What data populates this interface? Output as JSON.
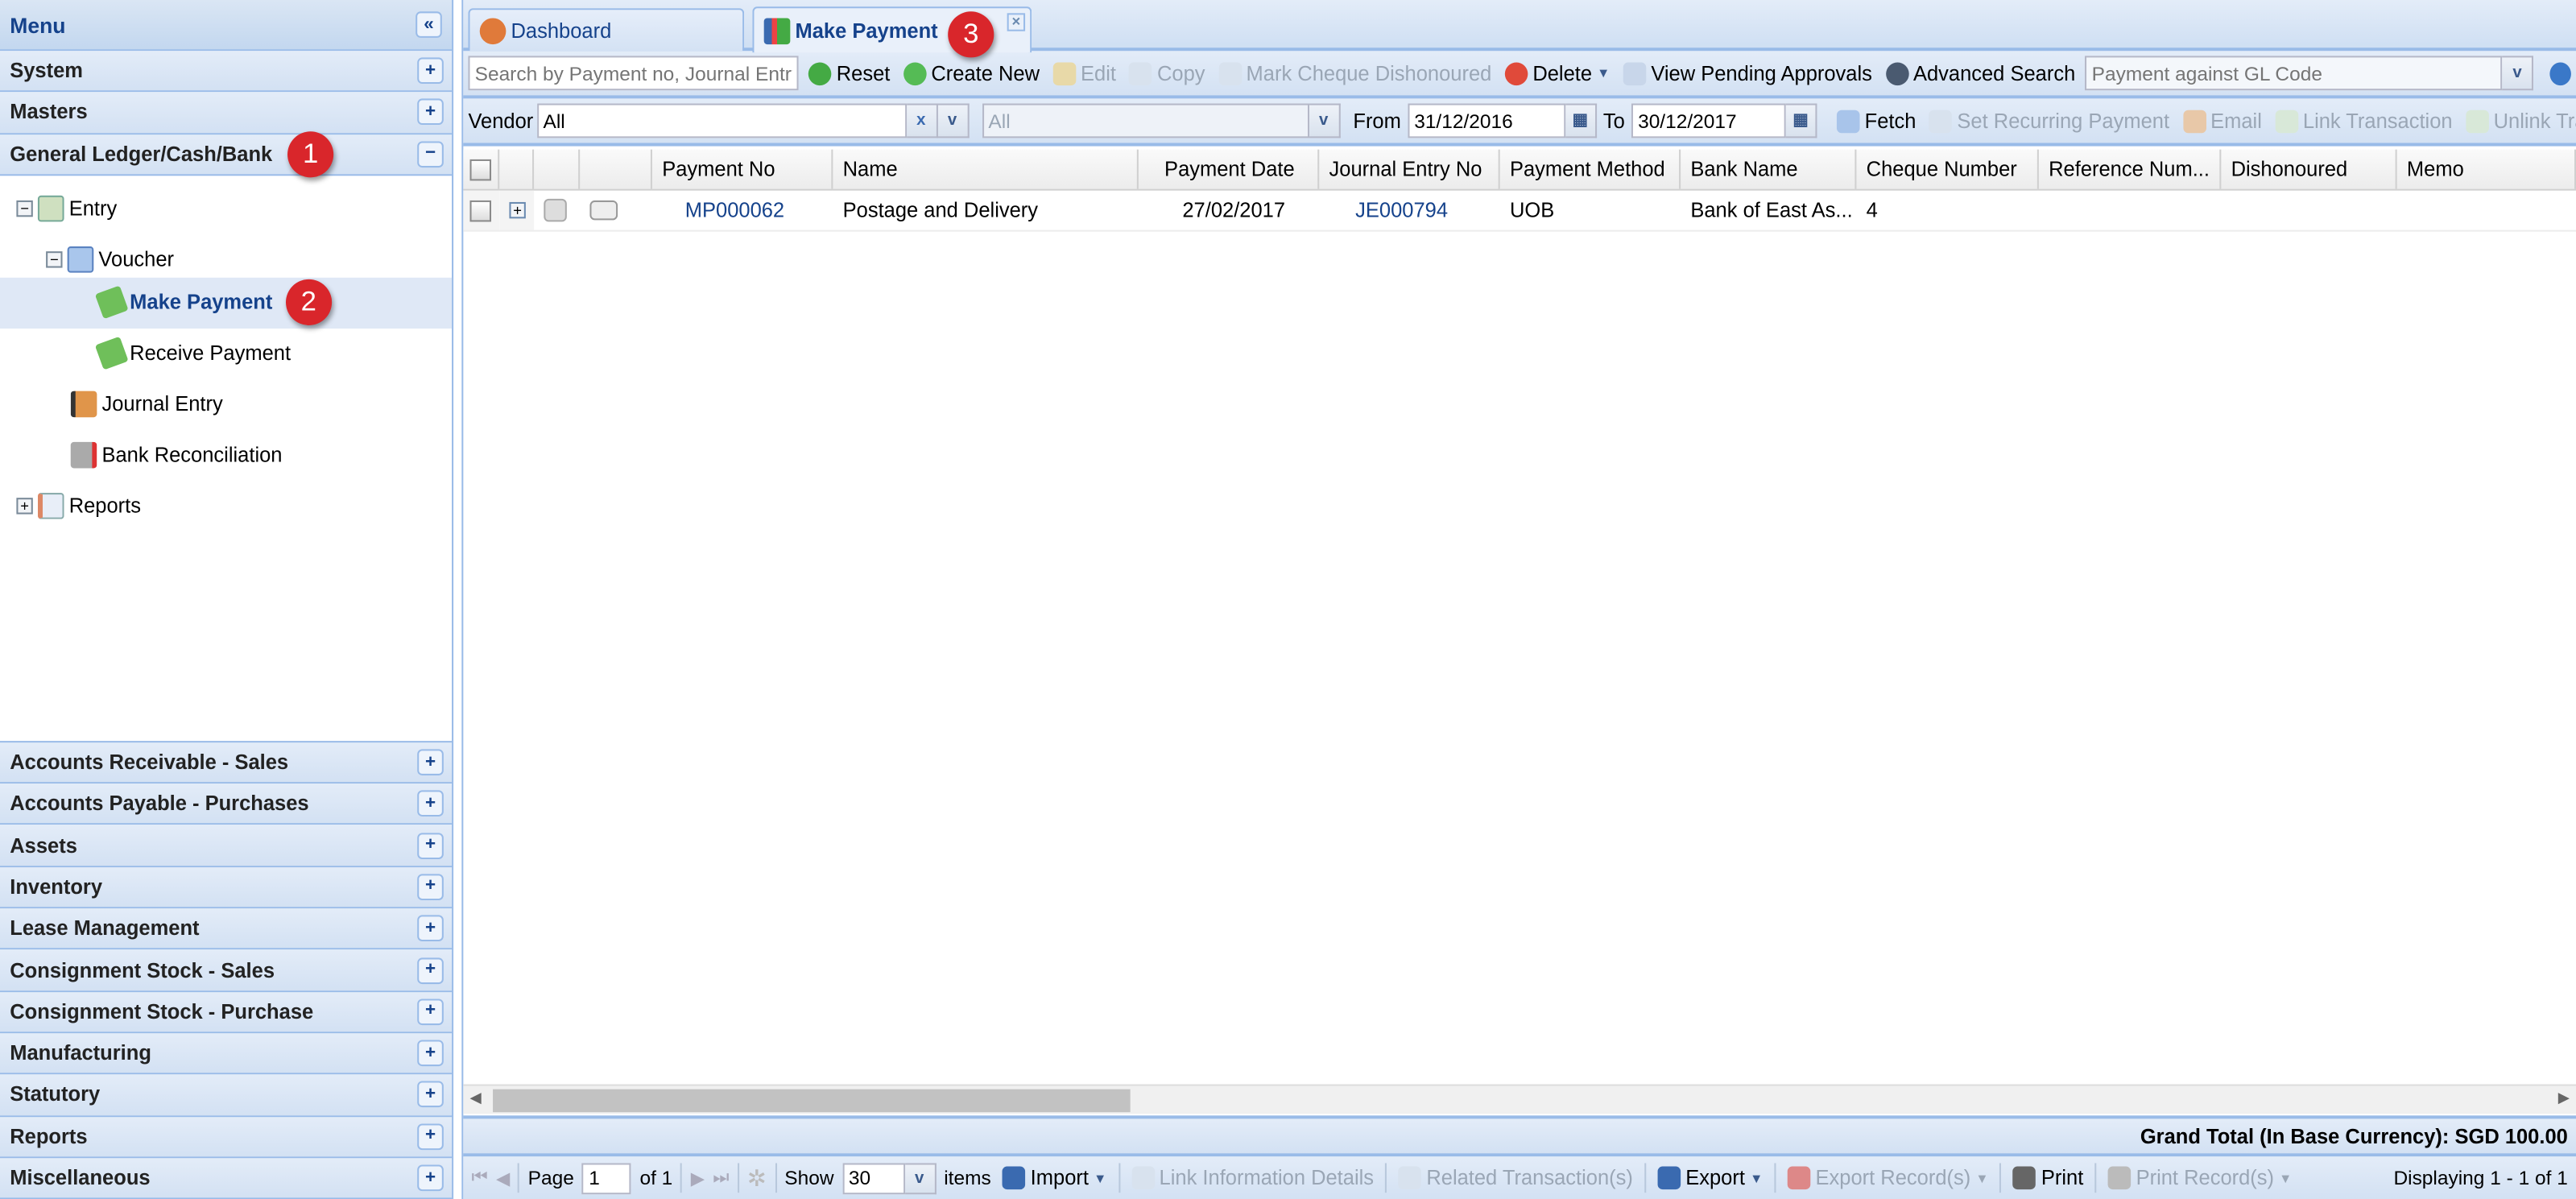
{
  "sidebar": {
    "title": "Menu",
    "top_sections": [
      {
        "label": "System",
        "state": "collapsed"
      },
      {
        "label": "Masters",
        "state": "collapsed"
      },
      {
        "label": "General Ledger/Cash/Bank",
        "state": "expanded",
        "badge": "1"
      }
    ],
    "tree": [
      {
        "label": "Entry",
        "icon": "entry-icon",
        "expanded": true
      },
      {
        "label": "Voucher",
        "icon": "voucher-icon",
        "expanded": true
      },
      {
        "label": "Make Payment",
        "icon": "money-icon",
        "selected": true,
        "badge": "2"
      },
      {
        "label": "Receive Payment",
        "icon": "money-icon"
      },
      {
        "label": "Journal Entry",
        "icon": "journal-icon"
      },
      {
        "label": "Bank Reconciliation",
        "icon": "bank-icon"
      },
      {
        "label": "Reports",
        "icon": "report-icon",
        "expanded": false
      }
    ],
    "bottom_sections": [
      "Accounts Receivable - Sales",
      "Accounts Payable - Purchases",
      "Assets",
      "Inventory",
      "Lease Management",
      "Consignment Stock - Sales",
      "Consignment Stock - Purchase",
      "Manufacturing",
      "Statutory",
      "Reports",
      "Miscellaneous"
    ]
  },
  "tabs": [
    {
      "label": "Dashboard"
    },
    {
      "label": "Make Payment",
      "active": true,
      "badge": "3"
    }
  ],
  "toolbar1": {
    "search_placeholder": "Search by Payment no, Journal Entry no",
    "reset": "Reset",
    "create_new": "Create New",
    "edit": "Edit",
    "copy": "Copy",
    "mark_cheque": "Mark Cheque Dishonoured",
    "delete": "Delete",
    "view_pending": "View Pending Approvals",
    "advanced_search": "Advanced Search",
    "gl_code_placeholder": "Payment against GL Code"
  },
  "toolbar2": {
    "vendor_label": "Vendor",
    "vendor_value": "All",
    "second_value": "All",
    "from_label": "From",
    "from_value": "31/12/2016",
    "to_label": "To",
    "to_value": "30/12/2017",
    "fetch": "Fetch",
    "set_recurring": "Set Recurring Payment",
    "email": "Email",
    "link_transaction": "Link Transaction",
    "unlink_transaction": "Unlink Tran"
  },
  "grid": {
    "columns": [
      "Payment No",
      "Name",
      "Payment Date",
      "Journal Entry No",
      "Payment Method",
      "Bank Name",
      "Cheque Number",
      "Reference Num...",
      "Dishonoured",
      "Memo"
    ],
    "rows": [
      {
        "payment_no": "MP000062",
        "name": "Postage and Delivery",
        "payment_date": "27/02/2017",
        "journal_entry_no": "JE000794",
        "payment_method": "UOB",
        "bank_name": "Bank of East As...",
        "cheque_number": "4",
        "reference": "",
        "dishonoured": "",
        "memo": ""
      }
    ]
  },
  "grand_total": "Grand Total (In Base Currency): SGD 100.00",
  "pager": {
    "page_label": "Page",
    "page_value": "1",
    "of_label": "of 1",
    "show_label": "Show",
    "show_value": "30",
    "items_label": "items",
    "import": "Import",
    "link_info": "Link Information Details",
    "related": "Related Transaction(s)",
    "export": "Export",
    "export_records": "Export Record(s)",
    "print": "Print",
    "print_records": "Print Record(s)",
    "displaying": "Displaying 1 - 1 of 1"
  },
  "colors": {
    "accent": "#15428b",
    "border": "#99bbe8",
    "badge": "#d9262b"
  }
}
